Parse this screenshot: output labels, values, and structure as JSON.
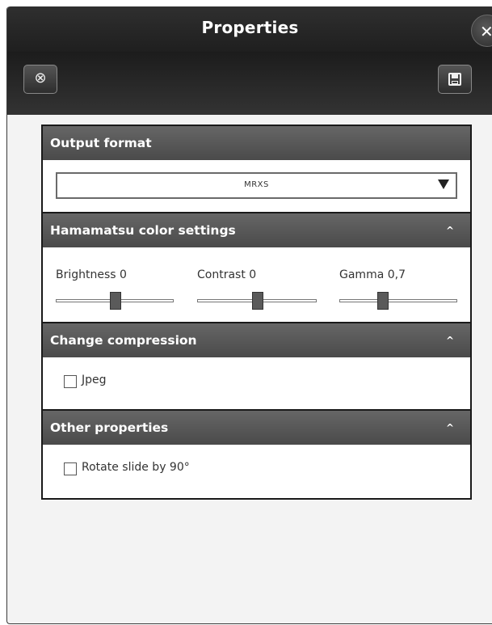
{
  "window": {
    "title": "Properties",
    "close_glyph": "✕"
  },
  "toolbar": {
    "reset_icon": "reset-icon",
    "reset_glyph": "⊗",
    "save_icon": "save-icon"
  },
  "sections": {
    "output_format": {
      "title": "Output format",
      "selected": "MRXS"
    },
    "color_settings": {
      "title": "Hamamatsu color settings",
      "caret": "^",
      "brightness_label": "Brightness 0",
      "brightness_value": 0.5,
      "contrast_label": "Contrast 0",
      "contrast_value": 0.5,
      "gamma_label": "Gamma 0,7",
      "gamma_value": 0.35
    },
    "compression": {
      "title": "Change compression",
      "caret": "^",
      "jpeg_label": "Jpeg",
      "jpeg_checked": false
    },
    "other": {
      "title": "Other properties",
      "caret": "^",
      "rotate_label": "Rotate slide by 90°",
      "rotate_checked": false
    }
  },
  "colors": {
    "titlebar": "#262626",
    "section_header": "#555555",
    "panel_border": "#1a1a1a",
    "background": "#f3f3f3"
  }
}
